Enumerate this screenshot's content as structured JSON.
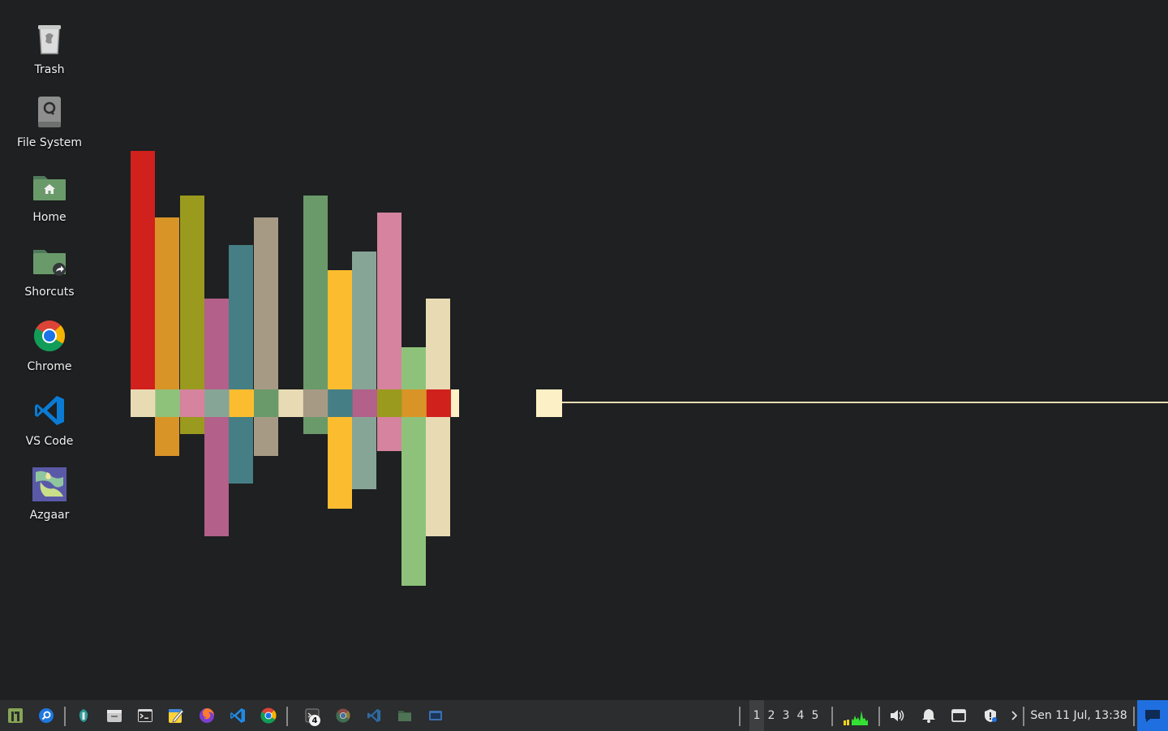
{
  "desktop": {
    "icons": [
      {
        "label": "Trash",
        "icon": "trash-icon"
      },
      {
        "label": "File System",
        "icon": "drive-icon"
      },
      {
        "label": "Home",
        "icon": "home-folder-icon"
      },
      {
        "label": "Shorcuts",
        "icon": "shortcut-folder-icon"
      },
      {
        "label": "Chrome",
        "icon": "chrome-icon"
      },
      {
        "label": "VS Code",
        "icon": "vscode-icon"
      },
      {
        "label": "Azgaar",
        "icon": "map-image-icon"
      }
    ]
  },
  "wallpaper": {
    "palette": {
      "red": "#d0211d",
      "orange": "#d99427",
      "olive": "#9a9a1e",
      "plum": "#b3608a",
      "teal": "#457f85",
      "taupe": "#a79a85",
      "green": "#6a9a6a",
      "yellow": "#fbbd2f",
      "sage": "#86a596",
      "pink": "#d5839e",
      "lightgreen": "#8ec27a",
      "cream": "#e8dbb4",
      "lightcream": "#fbf0c6"
    }
  },
  "taskbar": {
    "launchers": [
      "app-menu-icon",
      "search-icon",
      "cleaner-icon",
      "file-manager-icon",
      "terminal-icon",
      "notes-icon",
      "browser-icon",
      "vscode-icon",
      "chrome-icon"
    ],
    "tasks": [
      "terminal-task-icon",
      "chrome-task-icon",
      "vscode-task-icon",
      "folder-task-icon",
      "window-task-icon"
    ],
    "task_badge": "4",
    "workspaces": [
      "1",
      "2",
      "3",
      "4",
      "5"
    ],
    "active_workspace": "1",
    "tray": [
      "cpu-graph-icon",
      "volume-icon",
      "bell-icon",
      "clipboard-icon",
      "vpn-shield-icon",
      "chevron-right-icon"
    ],
    "clock": "Sen 11 Jul, 13:38",
    "notification_icon": "chat-bubble-icon",
    "accent": "#1f6fe0"
  }
}
